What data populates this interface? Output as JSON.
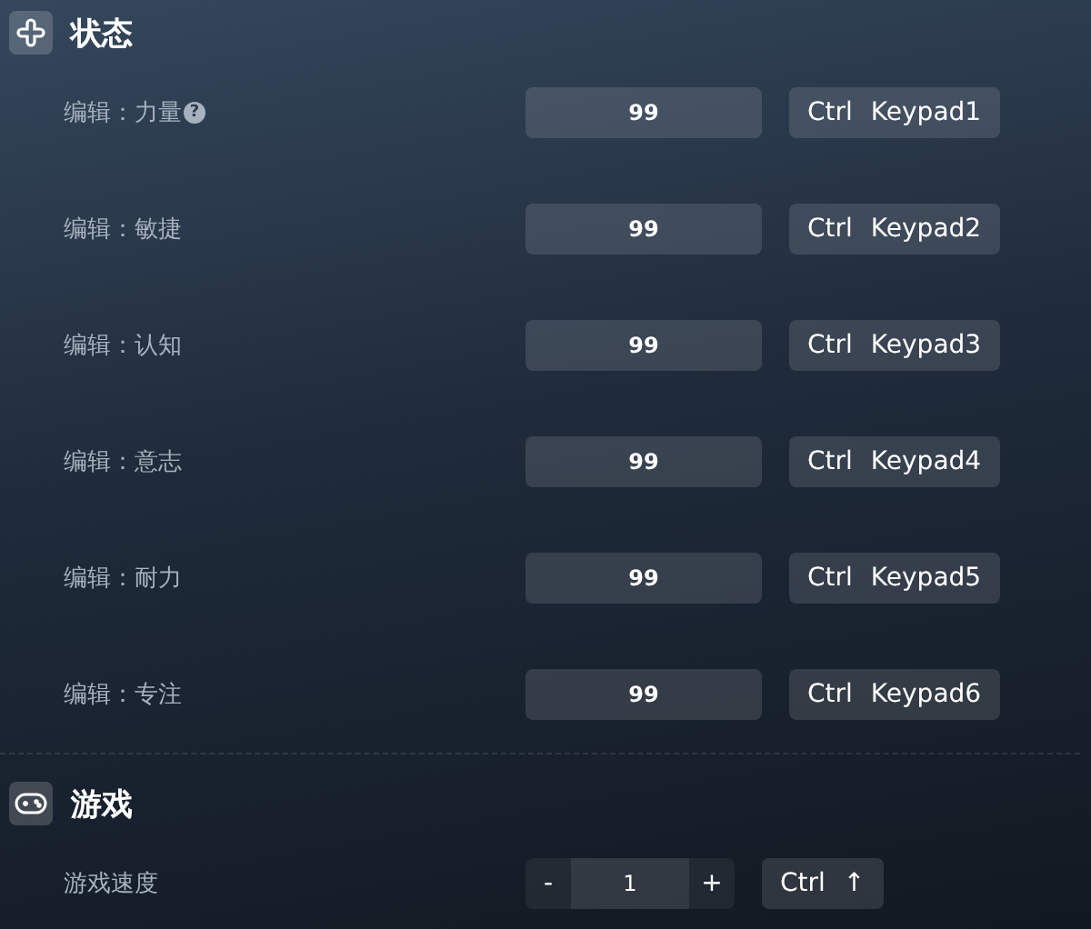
{
  "sections": [
    {
      "title": "状态",
      "kind": "stats",
      "rows": [
        {
          "kind": "input",
          "label": "编辑：力量",
          "help": "?",
          "value": "99",
          "keys": [
            "Ctrl",
            "Keypad1"
          ]
        },
        {
          "kind": "input",
          "label": "编辑：敏捷",
          "value": "99",
          "keys": [
            "Ctrl",
            "Keypad2"
          ]
        },
        {
          "kind": "input",
          "label": "编辑：认知",
          "value": "99",
          "keys": [
            "Ctrl",
            "Keypad3"
          ]
        },
        {
          "kind": "input",
          "label": "编辑：意志",
          "value": "99",
          "keys": [
            "Ctrl",
            "Keypad4"
          ]
        },
        {
          "kind": "input",
          "label": "编辑：耐力",
          "value": "99",
          "keys": [
            "Ctrl",
            "Keypad5"
          ]
        },
        {
          "kind": "input",
          "label": "编辑：专注",
          "value": "99",
          "keys": [
            "Ctrl",
            "Keypad6"
          ]
        }
      ]
    },
    {
      "title": "游戏",
      "kind": "game",
      "rows": [
        {
          "kind": "stepper",
          "label": "游戏速度",
          "minus": "-",
          "value": "1",
          "plus": "+",
          "keys": [
            "Ctrl",
            "↑"
          ]
        }
      ]
    }
  ]
}
